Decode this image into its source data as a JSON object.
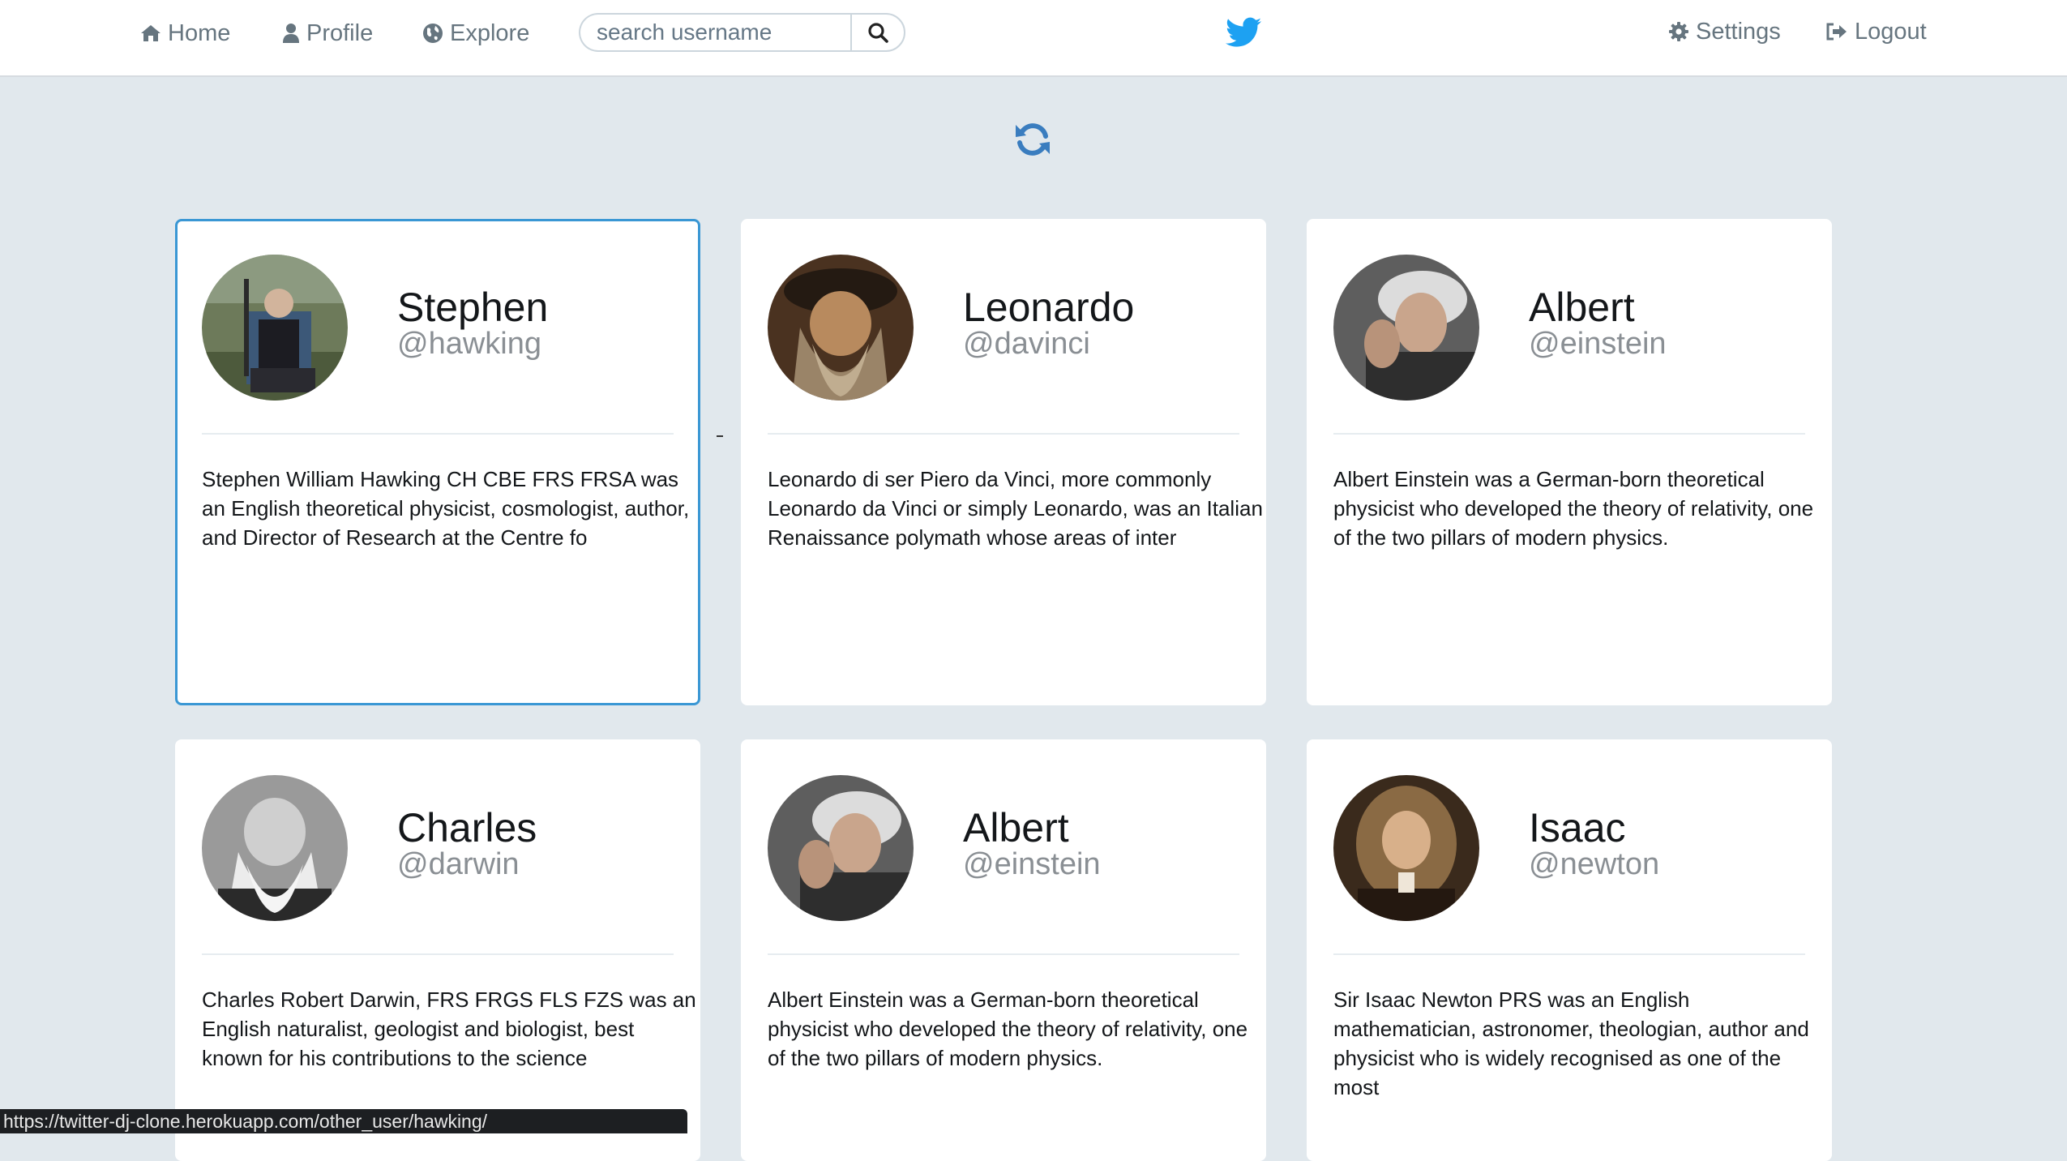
{
  "nav": {
    "home_label": "Home",
    "profile_label": "Profile",
    "explore_label": "Explore",
    "search_placeholder": "search username",
    "settings_label": "Settings",
    "logout_label": "Logout",
    "brand_icon": "twitter-bird-icon"
  },
  "colors": {
    "accent": "#1da1f2",
    "refresh": "#3a7dbf",
    "selected_border": "#3a97d4",
    "background": "#e1e8ed"
  },
  "cards": [
    {
      "name": "Stephen",
      "handle": "@hawking",
      "bio": "Stephen William Hawking CH CBE FRS FRSA was an English theoretical physicist, cosmologist, author, and Director of Research at the Centre fo",
      "selected": true
    },
    {
      "name": "Leonardo",
      "handle": "@davinci",
      "bio": "Leonardo di ser Piero da Vinci, more commonly Leonardo da Vinci or simply Leonardo, was an Italian Renaissance polymath whose areas of inter",
      "selected": false
    },
    {
      "name": "Albert",
      "handle": "@einstein",
      "bio": "Albert Einstein was a German-born theoretical physicist who developed the theory of relativity, one of the two pillars of modern physics.",
      "selected": false
    },
    {
      "name": "Charles",
      "handle": "@darwin",
      "bio": "Charles Robert Darwin, FRS FRGS FLS FZS was an English naturalist, geologist and biologist, best known for his contributions to the science",
      "selected": false
    },
    {
      "name": "Albert",
      "handle": "@einstein",
      "bio": "Albert Einstein was a German-born theoretical physicist who developed the theory of relativity, one of the two pillars of modern physics.",
      "selected": false
    },
    {
      "name": "Isaac",
      "handle": "@newton",
      "bio": "Sir Isaac Newton PRS was an English mathematician, astronomer, theologian, author and physicist who is widely recognised as one of the most",
      "selected": false
    }
  ],
  "status_url": "https://twitter-dj-clone.herokuapp.com/other_user/hawking/"
}
